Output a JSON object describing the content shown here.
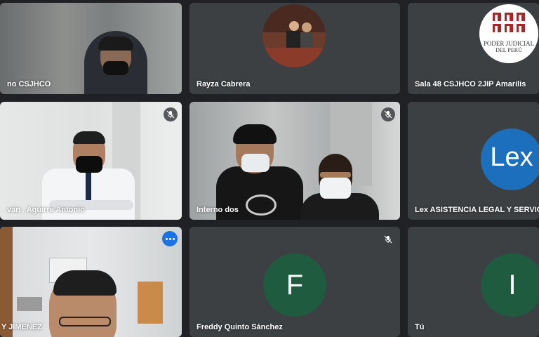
{
  "tiles": [
    {
      "name": "no CSJHCO"
    },
    {
      "name": "Rayza Cabrera"
    },
    {
      "name": "Sala 48 CSJHCO 2JIP Amarilis"
    },
    {
      "name": "ván . Aguirre Antonio"
    },
    {
      "name": "Interno dos"
    },
    {
      "name": "Lex ASISTENCIA LEGAL Y SERVIC"
    },
    {
      "name": "Y JIMENEZ"
    },
    {
      "name": "Freddy Quinto Sánchez",
      "initial": "F"
    },
    {
      "name": "Tú",
      "initial": "I"
    }
  ],
  "logos": {
    "pj_line1": "PODER JUDICIAL",
    "pj_line2": "DEL PERÚ",
    "lex": "Lex"
  },
  "icons": {
    "mic_muted": "mic-off-icon",
    "more": "more-options-icon"
  },
  "colors": {
    "tile_bg": "#3c4043",
    "page_bg": "#202124",
    "avatar_green": "#1f5c3f",
    "lex_blue": "#1b6fbd",
    "active_border": "#1a73e8"
  }
}
